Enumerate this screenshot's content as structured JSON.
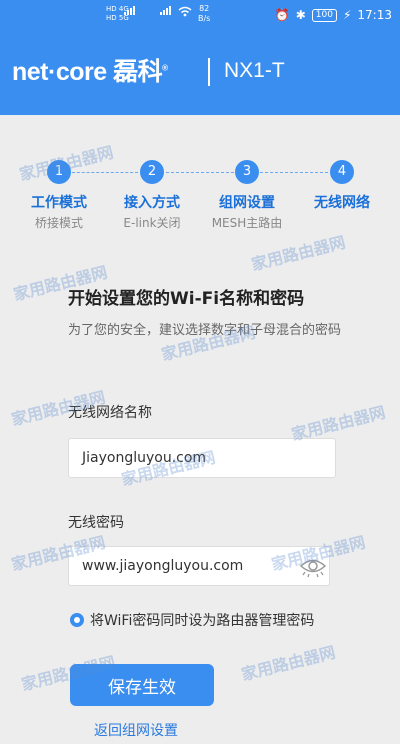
{
  "status_bar": {
    "signal_1": "HD 4G",
    "signal_2": "HD 5G",
    "net_speed_value": "82",
    "net_speed_unit": "B/s",
    "battery": "100",
    "time": "17:13"
  },
  "header": {
    "brand": "net·core",
    "brand_cn": "磊科",
    "model": "NX1-T"
  },
  "steps": [
    {
      "number": "1",
      "title": "工作模式",
      "sub": "桥接模式"
    },
    {
      "number": "2",
      "title": "接入方式",
      "sub": "E-link关闭"
    },
    {
      "number": "3",
      "title": "组网设置",
      "sub": "MESH主路由"
    },
    {
      "number": "4",
      "title": "无线网络",
      "sub": ""
    }
  ],
  "form": {
    "title": "开始设置您的Wi-Fi名称和密码",
    "description": "为了您的安全，建议选择数字和子母混合的密码",
    "ssid_label": "无线网络名称",
    "ssid_value": "Jiayongluyou.com",
    "password_label": "无线密码",
    "password_value": "www.jiayongluyou.com",
    "sync_password_label": "将WiFi密码同时设为路由器管理密码",
    "save_button": "保存生效",
    "back_link": "返回组网设置"
  },
  "watermark": {
    "text_cn": "家用路由器网",
    "text_en": "Jiayongluyou.com"
  },
  "colors": {
    "primary": "#3a8ef0",
    "background": "#ededed",
    "step_title": "#1a70d8"
  }
}
